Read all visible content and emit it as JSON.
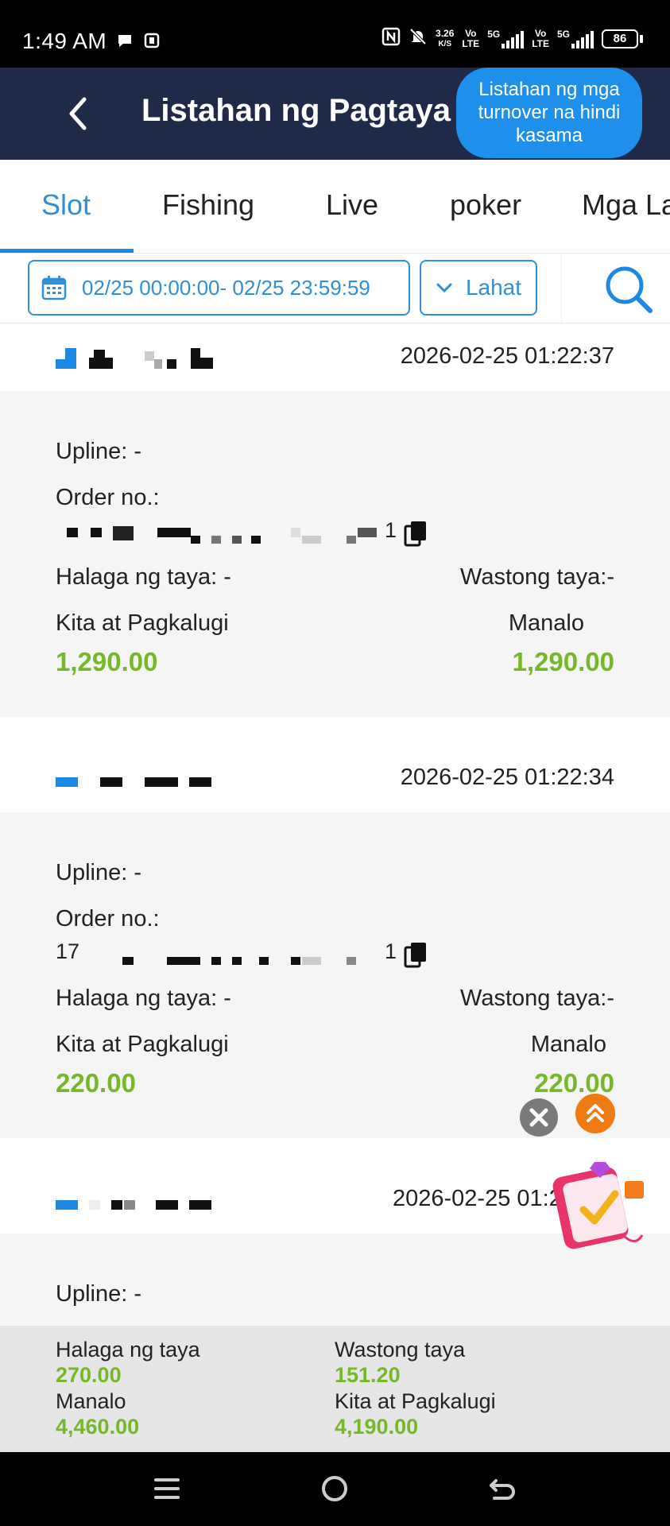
{
  "status_bar": {
    "time": "1:49 AM",
    "net_speed_top": "3.26",
    "net_speed_unit": "K/S",
    "volte_1": "Vo\nLTE",
    "sig1_label": "5G",
    "volte_2": "Vo\nLTE",
    "sig2_label": "5G",
    "battery": "86"
  },
  "header": {
    "title": "Listahan ng Pagtaya",
    "turnover_button": "Listahan ng mga turnover na hindi kasama",
    "back_icon": "chevron-left-icon"
  },
  "tabs": [
    {
      "label": "Slot",
      "active": true
    },
    {
      "label": "Fishing",
      "active": false
    },
    {
      "label": "Live",
      "active": false
    },
    {
      "label": "poker",
      "active": false
    },
    {
      "label": "Mga La",
      "active": false
    }
  ],
  "filters": {
    "date_range": "02/25 00:00:00- 02/25 23:59:59",
    "status_select": "Lahat",
    "calendar_icon": "calendar-icon",
    "search_icon": "search-icon"
  },
  "records": [
    {
      "time": "2026-02-25 01:22:37",
      "upline": "Upline: -",
      "order_label": "Order no.:",
      "order_suffix": "1",
      "bet_amount_label": "Halaga ng taya: -",
      "valid_bet_label": "Wastong taya:-",
      "profit_label": "Kita at Pagkalugi",
      "win_label": "Manalo",
      "profit_value": "1,290.00",
      "win_value": "1,290.00"
    },
    {
      "time": "2026-02-25 01:22:34",
      "upline": "Upline: -",
      "order_label": "Order no.:",
      "order_prefix": "17",
      "order_suffix": "1",
      "bet_amount_label": "Halaga ng taya: -",
      "valid_bet_label": "Wastong taya:-",
      "profit_label": "Kita at Pagkalugi",
      "win_label": "Manalo",
      "profit_value": "220.00",
      "win_value": "220.00"
    },
    {
      "time": "2026-02-25 01:2",
      "upline": "Upline: -"
    }
  ],
  "summary": {
    "bet_label": "Halaga ng taya",
    "bet_value": "270.00",
    "valid_label": "Wastong taya",
    "valid_value": "151.20",
    "win_label": "Manalo",
    "win_value": "4,460.00",
    "profit_label": "Kita at Pagkalugi",
    "profit_value": "4,190.00"
  },
  "colors": {
    "header_bg": "#1f2a48",
    "accent_blue": "#2f8fd8",
    "green": "#76b82a",
    "orange": "#f07a12"
  }
}
